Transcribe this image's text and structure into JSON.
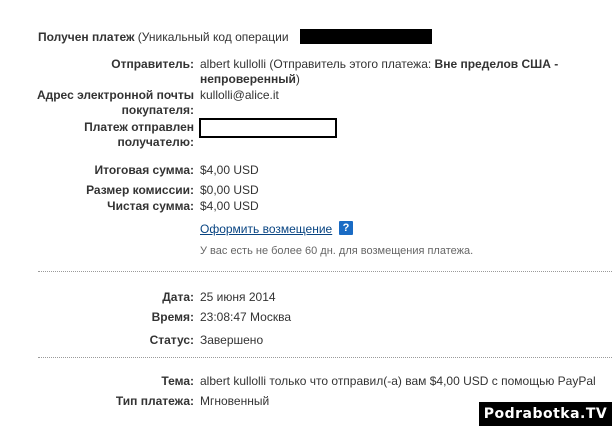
{
  "header": {
    "title_bold": "Получен платеж",
    "title_rest": " (Уникальный код операции"
  },
  "details": {
    "sender_label": "Отправитель:",
    "sender_name": "albert kullolli",
    "sender_note_prefix": " (Отправитель этого платежа: ",
    "sender_status": "Вне пределов США -",
    "sender_status2": "непроверенный",
    "sender_note_suffix": ")",
    "buyer_email_label_1": "Адрес электронной почты",
    "buyer_email_label_2": "покупателя:",
    "buyer_email": "kullolli@alice.it",
    "recipient_label_1": "Платеж отправлен",
    "recipient_label_2": "получателю:"
  },
  "amounts": {
    "total_label": "Итоговая сумма:",
    "total_value": "$4,00 USD",
    "fee_label": "Размер комиссии:",
    "fee_value": "$0,00 USD",
    "net_label": "Чистая сумма:",
    "net_value": "$4,00 USD",
    "refund_link": "Оформить возмещение",
    "help_icon": "?",
    "refund_note": "У вас есть не более 60 дн. для возмещения платежа."
  },
  "transaction": {
    "date_label": "Дата:",
    "date_value": "25 июня 2014",
    "time_label": "Время:",
    "time_value": "23:08:47 Москва",
    "status_label": "Статус:",
    "status_value": "Завершено"
  },
  "message": {
    "subject_label": "Тема:",
    "subject_value": "albert kullolli только что отправил(-а) вам $4,00 USD с помощью PayPal",
    "type_label": "Тип платежа:",
    "type_value": "Мгновенный"
  },
  "watermark": "Podrabotka.TV"
}
